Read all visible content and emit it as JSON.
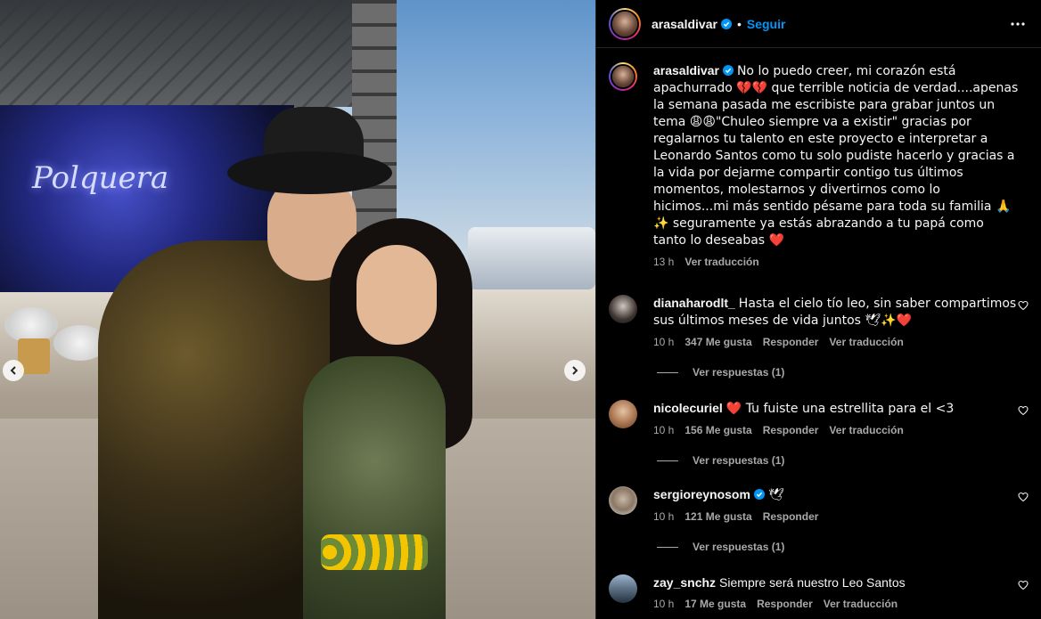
{
  "post": {
    "username": "arasaldivar",
    "verified": true,
    "separator": "•",
    "follow_label": "Seguir",
    "photo_sign": "Polquera",
    "caption": "No lo puedo creer, mi corazón está apachurrado 💔💔 que terrible noticia de verdad....apenas la semana pasada me escribiste para grabar juntos un tema 😩😩\"Chuleo siempre va a existir\" gracias por regalarnos tu talento en este proyecto e interpretar a Leonardo Santos como tu solo pudiste hacerlo y gracias a la vida por dejarme compartir contigo tus últimos momentos, molestarnos y divertirnos como lo hicimos...mi más sentido pésame para toda su familia 🙏✨ seguramente ya estás abrazando a tu papá como tanto lo deseabas ❤️",
    "caption_time": "13 h",
    "caption_translate": "Ver traducción"
  },
  "comments": [
    {
      "username": "dianaharodlt_",
      "verified": false,
      "text": "Hasta el cielo tío leo, sin saber compartimos sus últimos meses de vida juntos 🕊✨❤️",
      "time": "10 h",
      "likes": "347 Me gusta",
      "reply": "Responder",
      "translate": "Ver traducción",
      "replies": "Ver respuestas (1)"
    },
    {
      "username": "nicolecuriel",
      "verified": false,
      "text": "❤️ Tu fuiste una estrellita para el <3",
      "time": "10 h",
      "likes": "156 Me gusta",
      "reply": "Responder",
      "translate": "Ver traducción",
      "replies": "Ver respuestas (1)"
    },
    {
      "username": "sergioreynosom",
      "verified": true,
      "text": "🕊",
      "time": "10 h",
      "likes": "121 Me gusta",
      "reply": "Responder",
      "translate": "",
      "replies": "Ver respuestas (1)"
    },
    {
      "username": "zay_snchz",
      "verified": false,
      "text": "Siempre será nuestro Leo Santos",
      "time": "10 h",
      "likes": "17 Me gusta",
      "reply": "Responder",
      "translate": "Ver traducción",
      "replies": ""
    }
  ],
  "icons": {
    "verified": "verified-badge-icon",
    "more": "more-options-icon",
    "like": "heart-outline-icon",
    "prev": "chevron-left-icon",
    "next": "chevron-right-icon"
  },
  "colors": {
    "accent": "#0095f6",
    "text": "#f5f5f5",
    "muted": "#a8a8a8",
    "background": "#000000"
  }
}
